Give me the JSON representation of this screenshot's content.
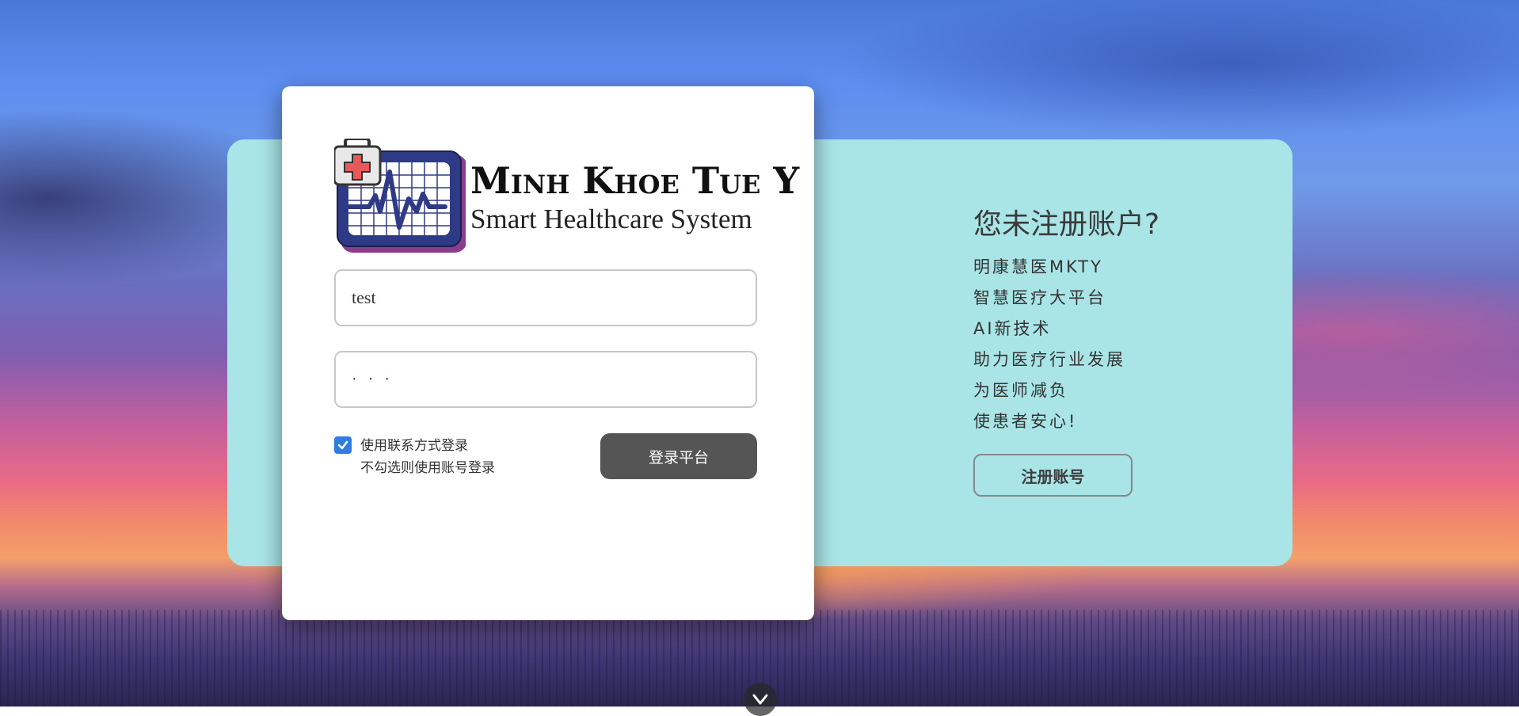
{
  "brand": {
    "title": "Minh Khoe Tue Y",
    "subtitle": "Smart Healthcare System"
  },
  "login": {
    "username_value": "test",
    "password_value": "···",
    "contact_login_checked": true,
    "contact_login_label": "使用联系方式登录",
    "contact_login_hint": "不勾选则使用账号登录",
    "login_button": "登录平台"
  },
  "promo": {
    "title": "您未注册账户?",
    "lines": [
      "明康慧医MKTY",
      "智慧医疗大平台",
      "AI新技术",
      "助力医疗行业发展",
      "为医师减负",
      "使患者安心!"
    ],
    "register_button": "注册账号"
  },
  "icons": {
    "logo": "medical-monitor-logo",
    "checkbox": "check-icon",
    "scroll": "chevron-down-icon"
  },
  "colors": {
    "panel": "#a9e5e6",
    "login_button": "#555555",
    "checkbox": "#2f7de1"
  }
}
